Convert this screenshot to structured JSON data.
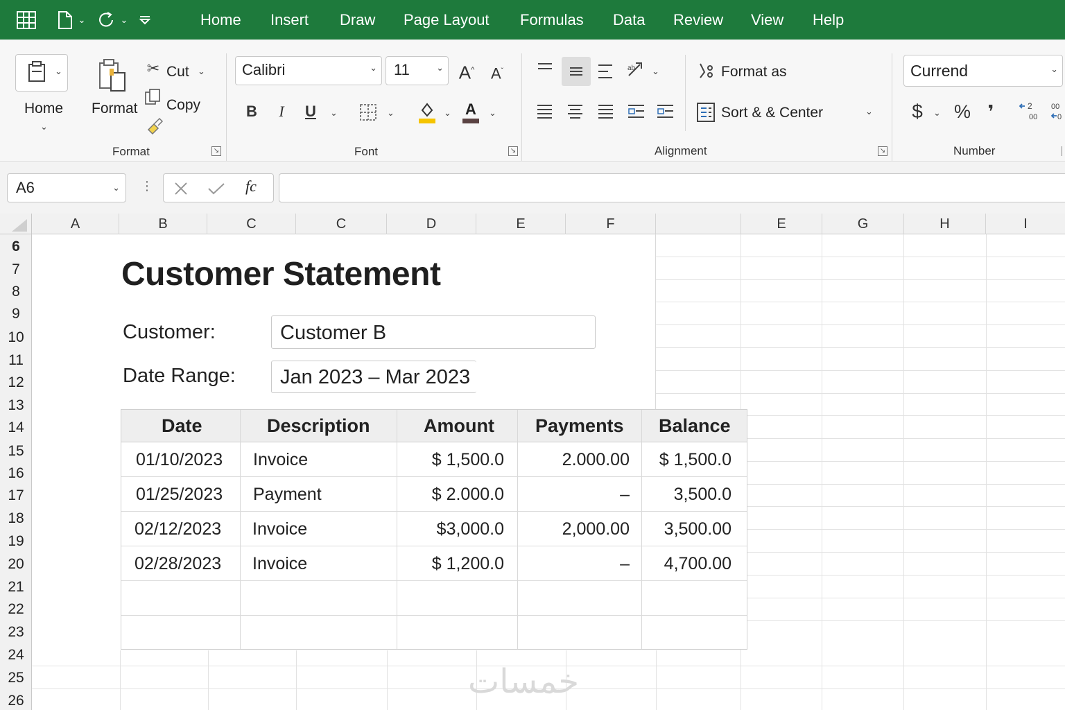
{
  "title_bar": {
    "icons": [
      "grid-icon",
      "new-file-icon",
      "redo-icon",
      "customize-icon"
    ],
    "menu": [
      "Home",
      "Insert",
      "Draw",
      "Page Layout",
      "Formulas",
      "Data",
      "Review",
      "View",
      "Help"
    ],
    "color": "#1e7a3c"
  },
  "ribbon": {
    "clipboard": {
      "home_label": "Home",
      "format_label": "Format",
      "cut_label": "Cut",
      "copy_label": "Copy",
      "group_label": "Format"
    },
    "font": {
      "font_name": "Calibri",
      "font_size": "11",
      "bold": "B",
      "italic": "I",
      "underline": "U",
      "group_label": "Font"
    },
    "alignment": {
      "format_as_label": "Format as",
      "sort_center_label": "Sort & & Center",
      "group_label": "Alignment"
    },
    "number": {
      "format_value": "Currend",
      "currency_symbol": "$",
      "percent_symbol": "%",
      "comma_symbol": "❜",
      "group_label": "Number"
    }
  },
  "formula_bar": {
    "name_box": "A6",
    "fx_label": "fc",
    "formula": ""
  },
  "columns": [
    "A",
    "B",
    "C",
    "C",
    "D",
    "E",
    "F",
    "E",
    "G",
    "H",
    "I"
  ],
  "rows": [
    "6",
    "7",
    "8",
    "9",
    "10",
    "11",
    "12",
    "13",
    "14",
    "15",
    "16",
    "17",
    "18",
    "19",
    "20",
    "21",
    "22",
    "23",
    "24",
    "25",
    "26"
  ],
  "statement": {
    "title": "Customer Statement",
    "customer_label": "Customer:",
    "customer_value": "Customer B",
    "date_range_label": "Date Range:",
    "date_range_value": "Jan 2023 – Mar 2023"
  },
  "table": {
    "headers": [
      "Date",
      "Description",
      "Amount",
      "Payments",
      "Balance"
    ],
    "rows": [
      [
        "01/10/2023",
        "Invoice",
        "$ 1,500.0",
        "2.000.00",
        "$ 1,500.0"
      ],
      [
        "01/25/2023",
        "Payment",
        "$ 2.000.0",
        "–",
        "3,500.0"
      ],
      [
        "02/12/2023",
        "Invoice",
        "$3,000.0",
        "2,000.00",
        "3,500.00"
      ],
      [
        "02/28/2023",
        "Invoice",
        "$ 1,200.0",
        "–",
        "4,700.00"
      ]
    ]
  },
  "watermark": "خمسات"
}
